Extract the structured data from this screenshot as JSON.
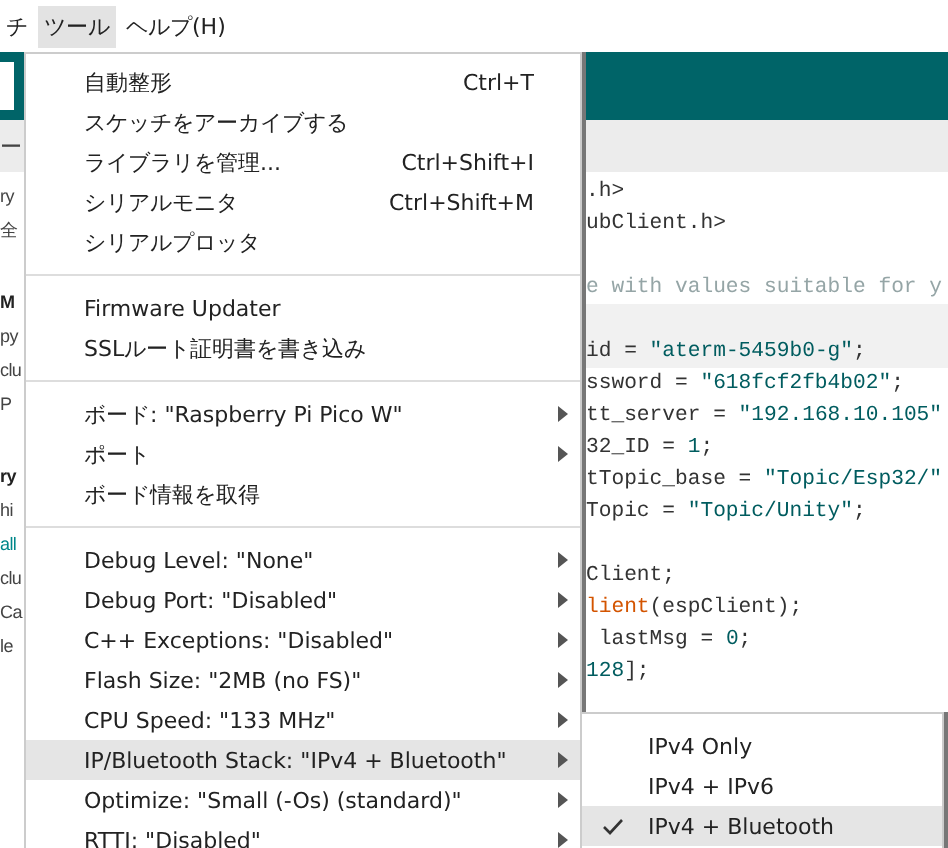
{
  "menu_bar": [
    {
      "label": "チ",
      "selected": false
    },
    {
      "label": "ツール",
      "selected": true
    },
    {
      "label": "ヘルプ(H)",
      "selected": false
    }
  ],
  "toolbar": {
    "fragment": "ー"
  },
  "sidebar": [
    {
      "text": "ry",
      "kind": "plain",
      "blank_before": false
    },
    {
      "text": "全",
      "kind": "plain",
      "blank_before": false
    },
    {
      "text": "M",
      "kind": "bold",
      "blank_before": true
    },
    {
      "text": "py",
      "kind": "plain",
      "blank_before": false
    },
    {
      "text": "clu",
      "kind": "plain",
      "blank_before": false
    },
    {
      "text": "P",
      "kind": "plain",
      "blank_before": false
    },
    {
      "text": "ry",
      "kind": "bold",
      "blank_before": true
    },
    {
      "text": "hi",
      "kind": "plain",
      "blank_before": false
    },
    {
      "text": "all",
      "kind": "link",
      "blank_before": false
    },
    {
      "text": "clu",
      "kind": "plain",
      "blank_before": false
    },
    {
      "text": "Ca",
      "kind": "plain",
      "blank_before": false
    },
    {
      "text": "le",
      "kind": "plain",
      "blank_before": false
    }
  ],
  "code_lines": [
    {
      "blank_before": false,
      "highlighted": false,
      "segments": [
        {
          "text": ".h>",
          "kind": "plain"
        }
      ]
    },
    {
      "blank_before": false,
      "highlighted": false,
      "segments": [
        {
          "text": "ubClient.h>",
          "kind": "plain"
        }
      ]
    },
    {
      "blank_before": true,
      "highlighted": false,
      "segments": [
        {
          "text": "e with values suitable for y",
          "kind": "comment"
        }
      ]
    },
    {
      "blank_before": true,
      "highlighted": true,
      "segments": [
        {
          "text": "id = ",
          "kind": "plain"
        },
        {
          "text": "\"aterm-5459b0-g\"",
          "kind": "string"
        },
        {
          "text": ";",
          "kind": "plain"
        }
      ]
    },
    {
      "blank_before": false,
      "highlighted": false,
      "segments": [
        {
          "text": "ssword = ",
          "kind": "plain"
        },
        {
          "text": "\"618fcf2fb4b02\"",
          "kind": "string"
        },
        {
          "text": ";",
          "kind": "plain"
        }
      ]
    },
    {
      "blank_before": false,
      "highlighted": false,
      "segments": [
        {
          "text": "tt_server = ",
          "kind": "plain"
        },
        {
          "text": "\"192.168.10.105\"",
          "kind": "string"
        }
      ]
    },
    {
      "blank_before": false,
      "highlighted": false,
      "segments": [
        {
          "text": "32_ID = ",
          "kind": "plain"
        },
        {
          "text": "1",
          "kind": "number"
        },
        {
          "text": ";",
          "kind": "plain"
        }
      ]
    },
    {
      "blank_before": false,
      "highlighted": false,
      "segments": [
        {
          "text": "tTopic_base = ",
          "kind": "plain"
        },
        {
          "text": "\"Topic/Esp32/\"",
          "kind": "string"
        }
      ]
    },
    {
      "blank_before": false,
      "highlighted": false,
      "segments": [
        {
          "text": "Topic = ",
          "kind": "plain"
        },
        {
          "text": "\"Topic/Unity\"",
          "kind": "string"
        },
        {
          "text": ";",
          "kind": "plain"
        }
      ]
    },
    {
      "blank_before": true,
      "highlighted": false,
      "segments": [
        {
          "text": "Client;",
          "kind": "plain"
        }
      ]
    },
    {
      "blank_before": false,
      "highlighted": false,
      "segments": [
        {
          "text": "lient",
          "kind": "keyword"
        },
        {
          "text": "(espClient);",
          "kind": "plain"
        }
      ]
    },
    {
      "blank_before": false,
      "highlighted": false,
      "segments": [
        {
          "text": " lastMsg = ",
          "kind": "plain"
        },
        {
          "text": "0",
          "kind": "number"
        },
        {
          "text": ";",
          "kind": "plain"
        }
      ]
    },
    {
      "blank_before": false,
      "highlighted": false,
      "segments": [
        {
          "text": "128",
          "kind": "number"
        },
        {
          "text": "];",
          "kind": "plain"
        }
      ]
    }
  ],
  "menu": {
    "sections": [
      {
        "items": [
          {
            "label": "自動整形",
            "shortcut": "Ctrl+T",
            "submenu": false,
            "selected": false
          },
          {
            "label": "スケッチをアーカイブする",
            "submenu": false,
            "selected": false
          },
          {
            "label": "ライブラリを管理...",
            "shortcut": "Ctrl+Shift+I",
            "submenu": false,
            "selected": false
          },
          {
            "label": "シリアルモニタ",
            "shortcut": "Ctrl+Shift+M",
            "submenu": false,
            "selected": false
          },
          {
            "label": "シリアルプロッタ",
            "submenu": false,
            "selected": false
          }
        ]
      },
      {
        "items": [
          {
            "label": "Firmware Updater",
            "submenu": false,
            "selected": false
          },
          {
            "label": "SSLルート証明書を書き込み",
            "submenu": false,
            "selected": false
          }
        ]
      },
      {
        "items": [
          {
            "label": "ボード: \"Raspberry Pi Pico W\"",
            "submenu": true,
            "selected": false
          },
          {
            "label": "ポート",
            "submenu": true,
            "selected": false
          },
          {
            "label": "ボード情報を取得",
            "submenu": false,
            "selected": false
          }
        ]
      },
      {
        "items": [
          {
            "label": "Debug Level: \"None\"",
            "submenu": true,
            "selected": false
          },
          {
            "label": "Debug Port: \"Disabled\"",
            "submenu": true,
            "selected": false
          },
          {
            "label": "C++ Exceptions: \"Disabled\"",
            "submenu": true,
            "selected": false
          },
          {
            "label": "Flash Size: \"2MB (no FS)\"",
            "submenu": true,
            "selected": false
          },
          {
            "label": "CPU Speed: \"133 MHz\"",
            "submenu": true,
            "selected": false
          },
          {
            "label": "IP/Bluetooth Stack: \"IPv4 + Bluetooth\"",
            "submenu": true,
            "selected": true
          },
          {
            "label": "Optimize: \"Small (-Os) (standard)\"",
            "submenu": true,
            "selected": false
          },
          {
            "label": "RTTI: \"Disabled\"",
            "submenu": true,
            "selected": false
          }
        ]
      }
    ]
  },
  "submenu": [
    {
      "label": "IPv4 Only",
      "checked": false,
      "selected": false
    },
    {
      "label": "IPv4 + IPv6",
      "checked": false,
      "selected": false
    },
    {
      "label": "IPv4 + Bluetooth",
      "checked": true,
      "selected": true
    }
  ]
}
